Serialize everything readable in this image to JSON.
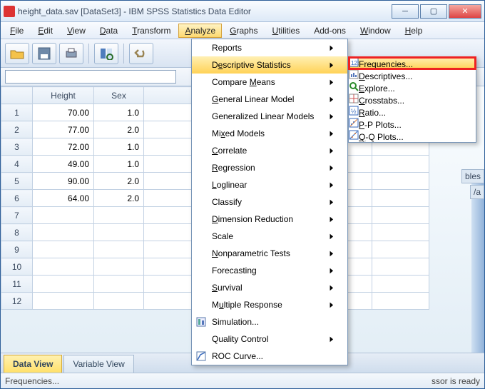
{
  "window": {
    "title": "height_data.sav [DataSet3] - IBM SPSS Statistics Data Editor"
  },
  "menubar": {
    "items": [
      "File",
      "Edit",
      "View",
      "Data",
      "Transform",
      "Analyze",
      "Graphs",
      "Utilities",
      "Add-ons",
      "Window",
      "Help"
    ],
    "underlines": [
      "F",
      "E",
      "V",
      "D",
      "T",
      "A",
      "G",
      "U",
      "O",
      "W",
      "H"
    ],
    "active": "Analyze"
  },
  "formula": {
    "value": ""
  },
  "columns": [
    "Height",
    "Sex"
  ],
  "rows": [
    {
      "n": 1,
      "Height": "70.00",
      "Sex": "1.0"
    },
    {
      "n": 2,
      "Height": "77.00",
      "Sex": "2.0"
    },
    {
      "n": 3,
      "Height": "72.00",
      "Sex": "1.0"
    },
    {
      "n": 4,
      "Height": "49.00",
      "Sex": "1.0"
    },
    {
      "n": 5,
      "Height": "90.00",
      "Sex": "2.0"
    },
    {
      "n": 6,
      "Height": "64.00",
      "Sex": "2.0"
    },
    {
      "n": 7,
      "Height": "",
      "Sex": ""
    },
    {
      "n": 8,
      "Height": "",
      "Sex": ""
    },
    {
      "n": 9,
      "Height": "",
      "Sex": ""
    },
    {
      "n": 10,
      "Height": "",
      "Sex": ""
    },
    {
      "n": 11,
      "Height": "",
      "Sex": ""
    },
    {
      "n": 12,
      "Height": "",
      "Sex": ""
    }
  ],
  "tabs": {
    "data": "Data View",
    "var": "Variable View"
  },
  "status": {
    "left": "Frequencies...",
    "right": "ssor is ready"
  },
  "analyze_menu": {
    "items": [
      {
        "label": "Reports",
        "arrow": true
      },
      {
        "label": "Descriptive Statistics",
        "arrow": true,
        "hl": true
      },
      {
        "label": "Compare Means",
        "arrow": true
      },
      {
        "label": "General Linear Model",
        "arrow": true
      },
      {
        "label": "Generalized Linear Models",
        "arrow": true
      },
      {
        "label": "Mixed Models",
        "arrow": true
      },
      {
        "label": "Correlate",
        "arrow": true
      },
      {
        "label": "Regression",
        "arrow": true
      },
      {
        "label": "Loglinear",
        "arrow": true
      },
      {
        "label": "Classify",
        "arrow": true
      },
      {
        "label": "Dimension Reduction",
        "arrow": true
      },
      {
        "label": "Scale",
        "arrow": true
      },
      {
        "label": "Nonparametric Tests",
        "arrow": true
      },
      {
        "label": "Forecasting",
        "arrow": true
      },
      {
        "label": "Survival",
        "arrow": true
      },
      {
        "label": "Multiple Response",
        "arrow": true
      },
      {
        "label": "Simulation...",
        "arrow": false,
        "icon": "sim"
      },
      {
        "label": "Quality Control",
        "arrow": true
      },
      {
        "label": "ROC Curve...",
        "arrow": false,
        "icon": "roc"
      }
    ],
    "underlines": [
      "",
      "e",
      "M",
      "G",
      "",
      "x",
      "C",
      "R",
      "L",
      "",
      "D",
      "A",
      "N",
      "",
      "S",
      "u",
      "",
      "",
      "V"
    ]
  },
  "desc_submenu": {
    "items": [
      {
        "label": "Frequencies...",
        "icon": "freq"
      },
      {
        "label": "Descriptives...",
        "icon": "desc"
      },
      {
        "label": "Explore...",
        "icon": "expl"
      },
      {
        "label": "Crosstabs...",
        "icon": "cross"
      },
      {
        "label": "Ratio...",
        "icon": "ratio"
      },
      {
        "label": "P-P Plots...",
        "icon": "pp"
      },
      {
        "label": "Q-Q Plots...",
        "icon": "qq"
      }
    ],
    "underlines": [
      "F",
      "D",
      "E",
      "C",
      "R",
      "P",
      "Q"
    ]
  },
  "side": {
    "bles": "bles",
    "va": "/a"
  }
}
